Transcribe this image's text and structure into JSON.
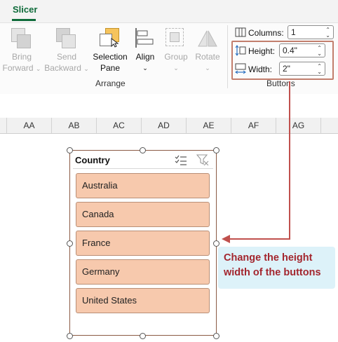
{
  "ribbon": {
    "tab": "Slicer",
    "buttons": {
      "bring_forward": [
        "Bring",
        "Forward"
      ],
      "send_backward": [
        "Send",
        "Backward"
      ],
      "selection_pane": [
        "Selection",
        "Pane"
      ],
      "align": "Align",
      "group": "Group",
      "rotate": "Rotate"
    },
    "groups": {
      "arrange": "Arrange",
      "buttons": "Buttons"
    },
    "fields": {
      "columns": {
        "label": "Columns:",
        "value": "1"
      },
      "height": {
        "label": "Height:",
        "value": "0.4\""
      },
      "width": {
        "label": "Width:",
        "value": "2\""
      }
    }
  },
  "columns": [
    "AA",
    "AB",
    "AC",
    "AD",
    "AE",
    "AF",
    "AG"
  ],
  "slicer": {
    "title": "Country",
    "items": [
      "Australia",
      "Canada",
      "France",
      "Germany",
      "United States"
    ]
  },
  "annotation": {
    "line1": "Change the height",
    "line2": "width of the buttons"
  },
  "colors": {
    "accent": "#0e6b3a",
    "button_fill": "#f7c9ad",
    "annotation_text": "#a3262e",
    "arrow": "#c0504d"
  }
}
